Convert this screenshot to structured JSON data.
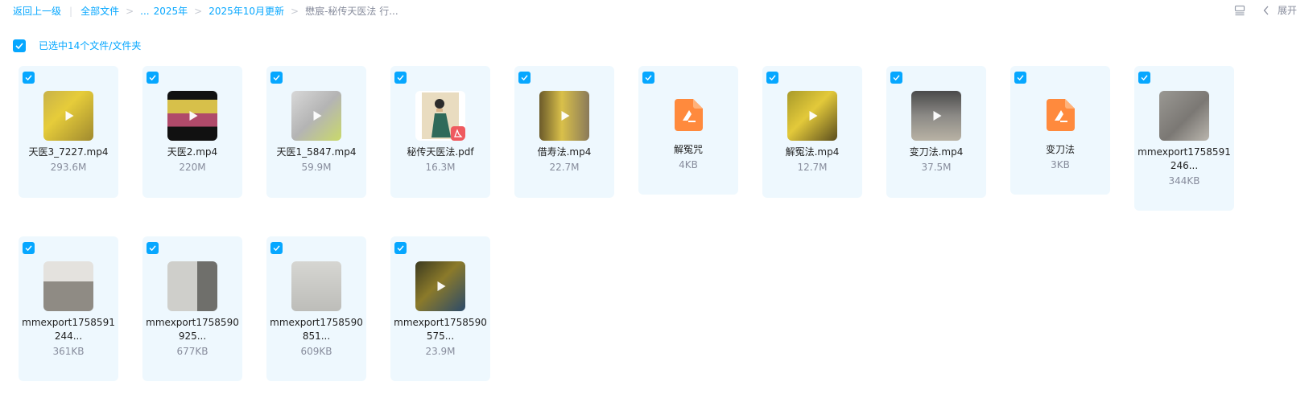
{
  "breadcrumb": {
    "back": "返回上一级",
    "all_files": "全部文件",
    "ellipsis": "...",
    "year": "2025年",
    "month": "2025年10月更新",
    "current": "懋宸-秘传天医法 行..."
  },
  "toolbar": {
    "expand_label": "展开"
  },
  "selection": {
    "label": "已选中14个文件/文件夹"
  },
  "files": [
    {
      "name": "天医3_7227.mp4",
      "size": "293.6M",
      "type": "video"
    },
    {
      "name": "天医2.mp4",
      "size": "220M",
      "type": "video"
    },
    {
      "name": "天医1_5847.mp4",
      "size": "59.9M",
      "type": "video"
    },
    {
      "name": "秘传天医法.pdf",
      "size": "16.3M",
      "type": "pdf"
    },
    {
      "name": "借寿法.mp4",
      "size": "22.7M",
      "type": "video"
    },
    {
      "name": "解冤咒",
      "size": "4KB",
      "type": "doc"
    },
    {
      "name": "解冤法.mp4",
      "size": "12.7M",
      "type": "video"
    },
    {
      "name": "变刀法.mp4",
      "size": "37.5M",
      "type": "video"
    },
    {
      "name": "变刀法",
      "size": "3KB",
      "type": "doc"
    },
    {
      "name": "mmexport1758591246...",
      "size": "344KB",
      "type": "image"
    },
    {
      "name": "mmexport1758591244...",
      "size": "361KB",
      "type": "image"
    },
    {
      "name": "mmexport1758590925...",
      "size": "677KB",
      "type": "image"
    },
    {
      "name": "mmexport1758590851...",
      "size": "609KB",
      "type": "image"
    },
    {
      "name": "mmexport1758590575...",
      "size": "23.9M",
      "type": "video"
    }
  ],
  "colors": {
    "accent": "#06a7ff",
    "card_bg": "#eef8fe",
    "doc_icon": "#ff8a3d",
    "pdf_badge": "#ef5a5f"
  }
}
